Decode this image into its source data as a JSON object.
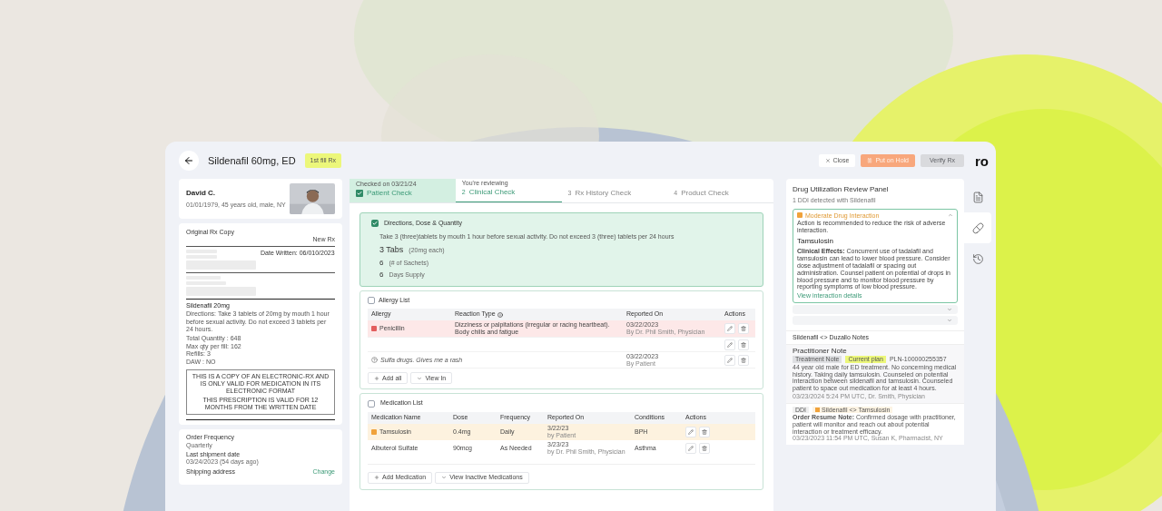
{
  "header": {
    "title": "Sildenafil 60mg, ED",
    "badge": "1st fill Rx",
    "logo": "ro",
    "buttons": [
      {
        "kind": "close",
        "label": "Close",
        "disabled": false
      },
      {
        "kind": "hold",
        "label": "Put on Hold",
        "disabled": false
      },
      {
        "kind": "verify",
        "label": "Verify Rx",
        "disabled": true
      }
    ]
  },
  "patient": {
    "name": "David C.",
    "details": "01/01/1979, 45 years old, male, NY"
  },
  "rx_copy": {
    "title": "Original Rx Copy",
    "type": "New Rx",
    "date_written": "Date Written: 06/010/2023",
    "drug": "Sildenafil 20mg",
    "directions": "Directions: Take 3 tablets of 20mg by mouth 1 hour before sexual activity. Do not exceed 3 tablets per 24 hours.",
    "lines": [
      "Total Quantity : 648",
      "Max qty per fill: 162",
      "Refills: 3",
      "DAW : NO"
    ],
    "notice": [
      "THIS IS A COPY OF AN ELECTRONIC-RX AND IS ONLY VALID FOR MEDICATION IN ITS ELECTRONIC FORMAT",
      "THIS PRESCRIPTION IS VALID FOR 12 MONTHS FROM THE WRITTEN DATE"
    ]
  },
  "order": {
    "fields": [
      {
        "label": "Order Frequency",
        "value": "Quarterly"
      },
      {
        "label": "Last shipment date",
        "value": "03/24/2023 (54 days ago)"
      },
      {
        "label": "Shipping address",
        "link": "Change"
      }
    ]
  },
  "tabs": [
    {
      "caption": "Checked on 03/21/24",
      "label": "Patient Check",
      "selected": false,
      "done": true
    },
    {
      "caption": "You're reviewing",
      "number": "2",
      "label": "Clinical Check",
      "selected": true,
      "done": false
    },
    {
      "number": "3",
      "label": "Rx History Check",
      "selected": false,
      "done": false
    },
    {
      "number": "4",
      "label": "Product Check",
      "selected": false,
      "done": false
    }
  ],
  "directions": {
    "title": "Directions, Dose & Quantity",
    "checked": true,
    "instruction": "Take 3 (three)tablets by mouth 1 hour before sexual activity. Do not exceed 3 (three) tablets per 24 hours",
    "quantities": [
      {
        "value": "3 Tabs",
        "unit": "(20mg each)"
      },
      {
        "value": "6",
        "unit": "(# of Sachets)"
      },
      {
        "value": "6",
        "unit": "Days Supply"
      }
    ]
  },
  "allergy_list": {
    "title": "Allergy List",
    "checked": false,
    "columns": [
      "Allergy",
      "Reaction Type",
      "Reported On",
      "Actions"
    ],
    "rows": [
      {
        "kind": "allergy",
        "flagged": true,
        "allergy": "Penicillin",
        "reaction": "Dizziness or palpitations (irregular or racing heartbeat). Body chills and fatigue",
        "date": "03/22/2023",
        "reporter": "By Dr. Phil Smith, Physician"
      },
      {
        "kind": "empty"
      },
      {
        "kind": "note",
        "text": "Sulfa drugs. Gives me a rash",
        "date": "03/22/2023",
        "reporter": "By Patient"
      }
    ],
    "buttons": [
      {
        "kind": "add",
        "label": "Add all"
      },
      {
        "kind": "view",
        "label": "View In"
      }
    ]
  },
  "medication_list": {
    "title": "Medication List",
    "checked": false,
    "columns": [
      "Medication Name",
      "Dose",
      "Frequency",
      "Reported On",
      "Conditions",
      "Actions"
    ],
    "rows": [
      {
        "flagged": true,
        "name": "Tamsulosin",
        "dose": "0.4mg",
        "frequency": "Daily",
        "date": "3/22/23",
        "reporter": "by Patient",
        "condition": "BPH"
      },
      {
        "flagged": false,
        "name": "Albuterol Sulfate",
        "dose": "90mcg",
        "frequency": "As Needed",
        "date": "3/23/23",
        "reporter": "by Dr. Phil Smith, Physician",
        "condition": "Asthma"
      }
    ],
    "buttons": [
      {
        "kind": "add",
        "label": "Add Medication"
      },
      {
        "kind": "view",
        "label": "View Inactive Medications"
      }
    ]
  },
  "dur_panel": {
    "title": "Drug Utilization Review Panel",
    "subtitle": "1 DDI detected with Sildenafil",
    "interactions": [
      {
        "expanded": true,
        "severity": "Moderate Drug Interaction",
        "summary": "Action is recommended to reduce the risk of adverse interaction.",
        "drug": "Tamsulosin",
        "effects": "**Clinical Effects:** Concurrent use of tadalafil and tamsulosin can lead to lower blood pressure. Consider dose adjustment of tadalafil or spacing out administration. Counsel patient on potential of drops in blood pressure and to monitor blood pressure by reporting symptoms of low blood pressure.",
        "link": "View interaction details"
      },
      {
        "expanded": false
      },
      {
        "expanded": false
      }
    ]
  },
  "notes": {
    "title": "Sildenafil <> Duzallo Notes",
    "items": [
      {
        "kind": "practitioner",
        "title": "Practitioner Note",
        "tags": [
          "Treatment Note",
          "Current plan"
        ],
        "id": "PLN-100000255357",
        "text": "44 year old male for ED treatment. No concerning medical history. Taking daily tamsulosin. Counseled on potential interaction between sildenafil and tamsulosin. Counseled patient to space out medication for at least 4 hours.",
        "meta": "03/23/2024 5:24 PM UTC, Dr. Smith, Physician"
      },
      {
        "kind": "ddi",
        "tag": "DDI",
        "pair": "Sildenafil <> Tamsulosin",
        "text": "**Order Resume Note:** Confirmed dosage with practitioner, patient will monitor and reach out about potential interaction or treatment efficacy.",
        "meta": "03/23/2023 11:54 PM UTC, Susan K, Pharmacist, NY"
      }
    ]
  },
  "rail": [
    {
      "kind": "document",
      "selected": false
    },
    {
      "kind": "pill",
      "selected": true
    },
    {
      "kind": "history",
      "selected": false
    }
  ]
}
